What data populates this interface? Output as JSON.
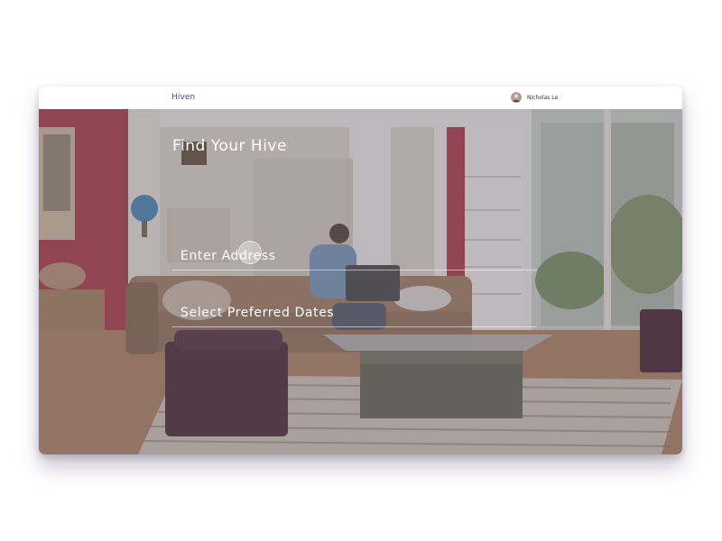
{
  "app": {
    "brand": "Hiven",
    "user_name": "Nicholas Le"
  },
  "hero": {
    "headline": "Find Your Hive",
    "fields": [
      {
        "label": "Enter Address"
      },
      {
        "label": "Select Preferred Dates"
      }
    ]
  },
  "colors": {
    "brand": "#6a2bbf",
    "overlay": "#70687a",
    "text_on_image": "#ffffff"
  },
  "icons": [
    "user-avatar"
  ]
}
